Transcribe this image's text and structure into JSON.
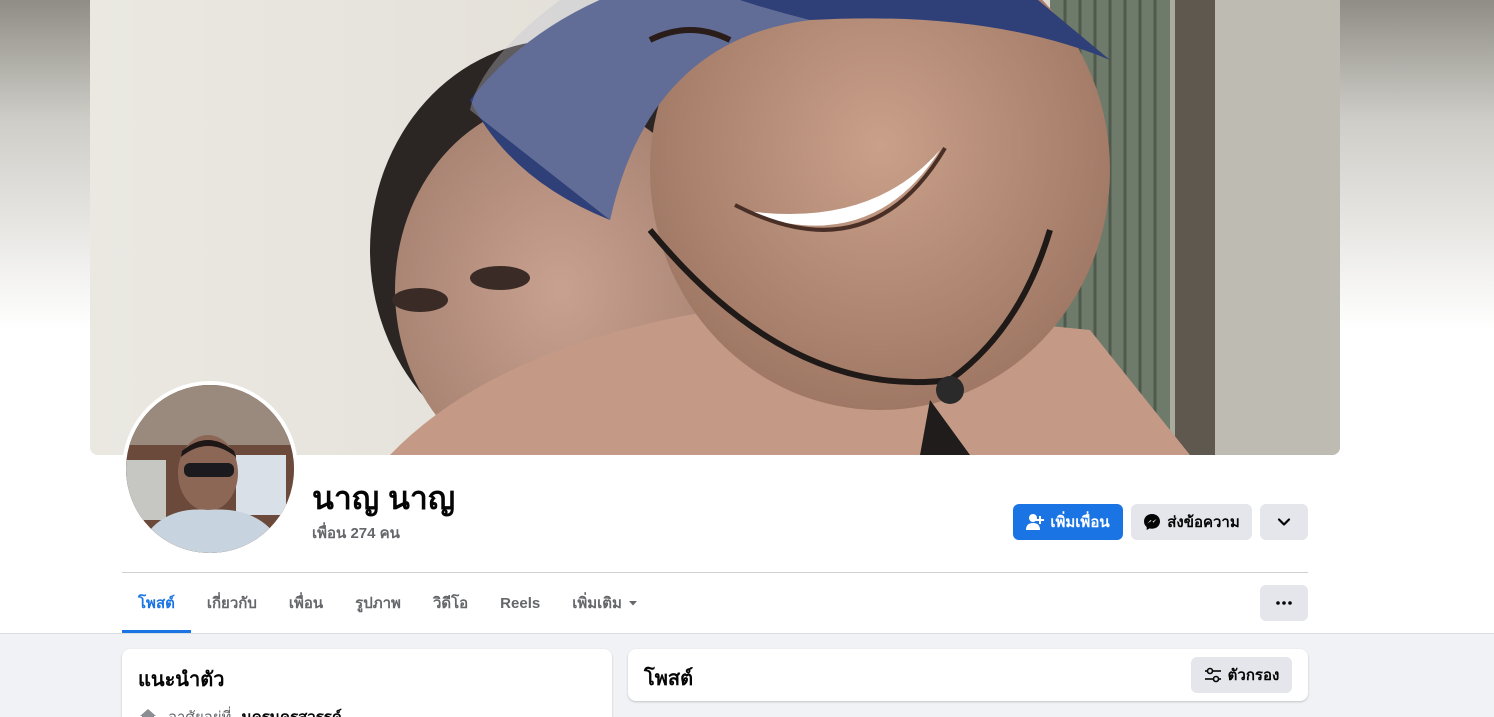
{
  "profile": {
    "name": "นาญ นาญ",
    "friends": "เพื่อน 274 คน"
  },
  "actions": {
    "add_friend": "เพิ่มเพื่อน",
    "message": "ส่งข้อความ"
  },
  "tabs": [
    {
      "label": "โพสต์",
      "active": true
    },
    {
      "label": "เกี่ยวกับ"
    },
    {
      "label": "เพื่อน"
    },
    {
      "label": "รูปภาพ"
    },
    {
      "label": "วิดีโอ"
    },
    {
      "label": "Reels"
    },
    {
      "label": "เพิ่มเติม"
    }
  ],
  "intro": {
    "title": "แนะนำตัว",
    "lives_prefix": "อาศัยอยู่ที่",
    "lives_place": "นครนครสวรรค์"
  },
  "posts": {
    "title": "โพสต์",
    "filter": "ตัวกรอง"
  },
  "colors": {
    "accent": "#1b74e4",
    "button_gray": "#e4e6eb",
    "page_bg": "#f0f2f5",
    "muted_text": "#65676b"
  }
}
